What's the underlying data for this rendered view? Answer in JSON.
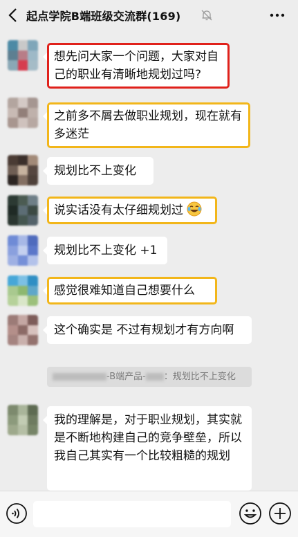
{
  "header": {
    "title": "起点学院B端班级交流群(169)"
  },
  "messages": [
    {
      "text": "想先问大家一个问题，大家对自己的职业有清晰地规划过吗?"
    },
    {
      "text": "之前多不屑去做职业规划，现在就有多迷茫"
    },
    {
      "text": "规划比不上变化"
    },
    {
      "text": "说实话没有太仔细规划过"
    },
    {
      "text": "规划比不上变化 +1"
    },
    {
      "text": "感觉很难知道自己想要什么"
    },
    {
      "text": "这个确实是 不过有规划才有方向啊"
    },
    {
      "text": "我的理解是，对于职业规划，其实就是不断地构建自己的竞争壁垒，所以我自己其实有一个比较粗糙的规划"
    }
  ],
  "quote": {
    "group_part": "-B端产品-",
    "text": "：规划比不上变化"
  },
  "colors": {
    "highlight_red": "#e0211b",
    "highlight_yellow": "#f2b61a",
    "background": "#ededed"
  },
  "icons": [
    "back-icon",
    "mute-bell-icon",
    "more-icon",
    "voice-icon",
    "emoji-icon",
    "plus-icon"
  ]
}
